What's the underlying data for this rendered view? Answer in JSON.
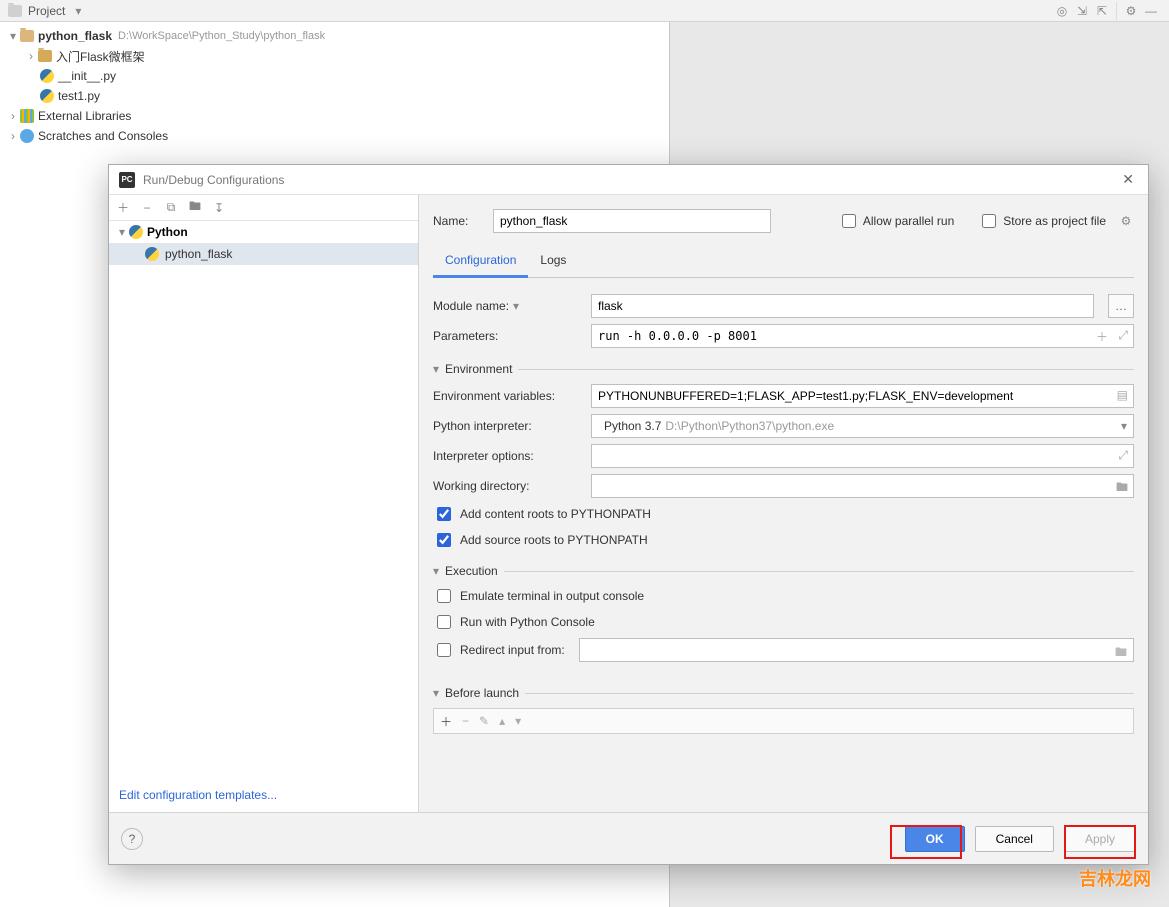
{
  "topbar": {
    "project_label": "Project"
  },
  "project_tree": {
    "root": {
      "name": "python_flask",
      "path": "D:\\WorkSpace\\Python_Study\\python_flask"
    },
    "children": [
      {
        "name": "入门Flask微框架",
        "type": "folder"
      },
      {
        "name": "__init__.py",
        "type": "py"
      },
      {
        "name": "test1.py",
        "type": "py"
      }
    ],
    "external": "External Libraries",
    "scratches": "Scratches and Consoles"
  },
  "dialog": {
    "title": "Run/Debug Configurations",
    "tree": {
      "parent": "Python",
      "child": "python_flask"
    },
    "edit_templates": "Edit configuration templates...",
    "name_label": "Name:",
    "name_value": "python_flask",
    "allow_parallel": "Allow parallel run",
    "store_project": "Store as project file",
    "tabs": {
      "configuration": "Configuration",
      "logs": "Logs"
    },
    "module_name_label": "Module name:",
    "module_name_value": "flask",
    "parameters_label": "Parameters:",
    "parameters_value": "run -h 0.0.0.0 -p 8001",
    "section_env": "Environment",
    "env_vars_label": "Environment variables:",
    "env_vars_value": "PYTHONUNBUFFERED=1;FLASK_APP=test1.py;FLASK_ENV=development",
    "interpreter_label": "Python interpreter:",
    "interpreter_value": "Python 3.7",
    "interpreter_path": "D:\\Python\\Python37\\python.exe",
    "interp_opts_label": "Interpreter options:",
    "interp_opts_value": "",
    "workdir_label": "Working directory:",
    "workdir_value": "",
    "add_content_roots": "Add content roots to PYTHONPATH",
    "add_source_roots": "Add source roots to PYTHONPATH",
    "section_exec": "Execution",
    "emulate_terminal": "Emulate terminal in output console",
    "run_python_console": "Run with Python Console",
    "redirect_input": "Redirect input from:",
    "section_before": "Before launch",
    "buttons": {
      "ok": "OK",
      "cancel": "Cancel",
      "apply": "Apply"
    }
  },
  "watermark": "吉林龙网"
}
